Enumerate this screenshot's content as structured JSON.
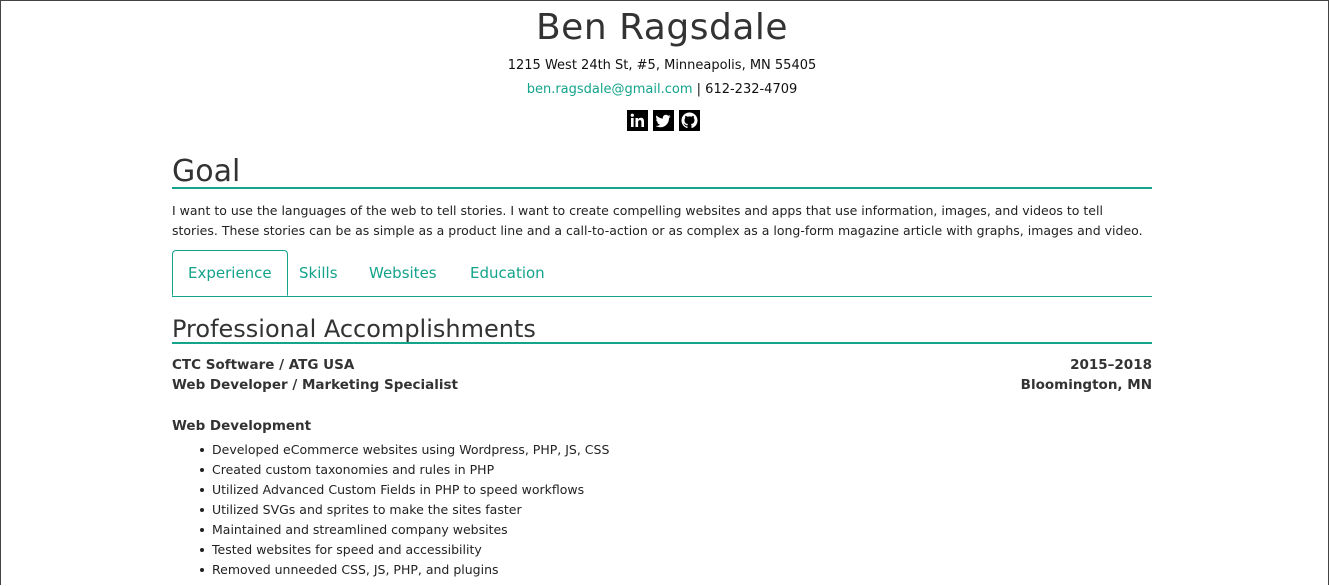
{
  "header": {
    "name": "Ben Ragsdale",
    "address": "1215 West 24th St, #5, Minneapolis, MN 55405",
    "email": "ben.ragsdale@gmail.com",
    "separator": " | ",
    "phone": "612-232-4709",
    "social": [
      "linkedin-icon",
      "twitter-icon",
      "github-icon"
    ]
  },
  "goal": {
    "title": "Goal",
    "text": "I want to use the languages of the web to tell stories. I want to create compelling websites and apps that use information, images, and videos to tell stories. These stories can be as simple as a product line and a call-to-action or as complex as a long-form magazine article with graphs, images and video."
  },
  "tabs": [
    {
      "label": "Experience",
      "active": true
    },
    {
      "label": "Skills",
      "active": false
    },
    {
      "label": "Websites",
      "active": false
    },
    {
      "label": "Education",
      "active": false
    }
  ],
  "experience": {
    "title": "Professional Accomplishments",
    "company": "CTC Software / ATG USA",
    "dates": "2015–2018",
    "role": "Web Developer / Marketing Specialist",
    "location": "Bloomington, MN",
    "section": "Web Development",
    "bullets": [
      "Developed eCommerce websites using Wordpress, PHP, JS, CSS",
      "Created custom taxonomies and rules in PHP",
      "Utilized Advanced Custom Fields in PHP to speed workflows",
      "Utilized SVGs and sprites to make the sites faster",
      "Maintained and streamlined company websites",
      "Tested websites for speed and accessibility",
      "Removed unneeded CSS, JS, PHP, and plugins"
    ]
  },
  "colors": {
    "accent": "#14a38b",
    "text": "#222222"
  }
}
